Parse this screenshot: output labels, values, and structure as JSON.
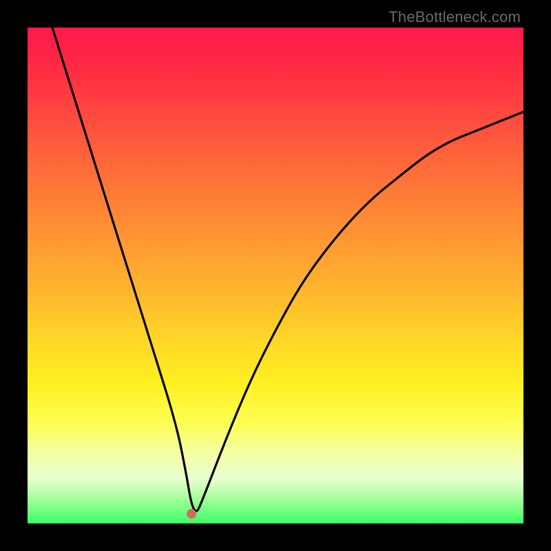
{
  "watermark": "TheBottleneck.com",
  "chart_data": {
    "type": "line",
    "title": "",
    "xlabel": "",
    "ylabel": "",
    "xlim": [
      0,
      100
    ],
    "ylim": [
      0,
      100
    ],
    "grid": false,
    "legend": false,
    "series": [
      {
        "name": "bottleneck-curve",
        "x": [
          5,
          10,
          15,
          20,
          25,
          30,
          32,
          33,
          34,
          35,
          40,
          45,
          50,
          55,
          60,
          65,
          70,
          75,
          80,
          85,
          90,
          95,
          100
        ],
        "y": [
          100,
          84,
          68,
          52,
          36,
          20,
          10,
          4,
          2,
          4,
          17,
          29,
          39,
          48,
          55,
          61,
          66,
          70,
          74,
          77,
          79,
          81,
          83
        ]
      }
    ],
    "marker": {
      "name": "bottleneck-minimum",
      "x": 33,
      "y": 2,
      "color": "#cf6b5c"
    },
    "background_gradient": {
      "stops": [
        {
          "pos": 0,
          "color": "#ff1a4d"
        },
        {
          "pos": 15,
          "color": "#ff4040"
        },
        {
          "pos": 40,
          "color": "#ff8f34"
        },
        {
          "pos": 62,
          "color": "#ffd428"
        },
        {
          "pos": 80,
          "color": "#fdff55"
        },
        {
          "pos": 95,
          "color": "#a5ff9a"
        },
        {
          "pos": 100,
          "color": "#3bff66"
        }
      ]
    }
  }
}
